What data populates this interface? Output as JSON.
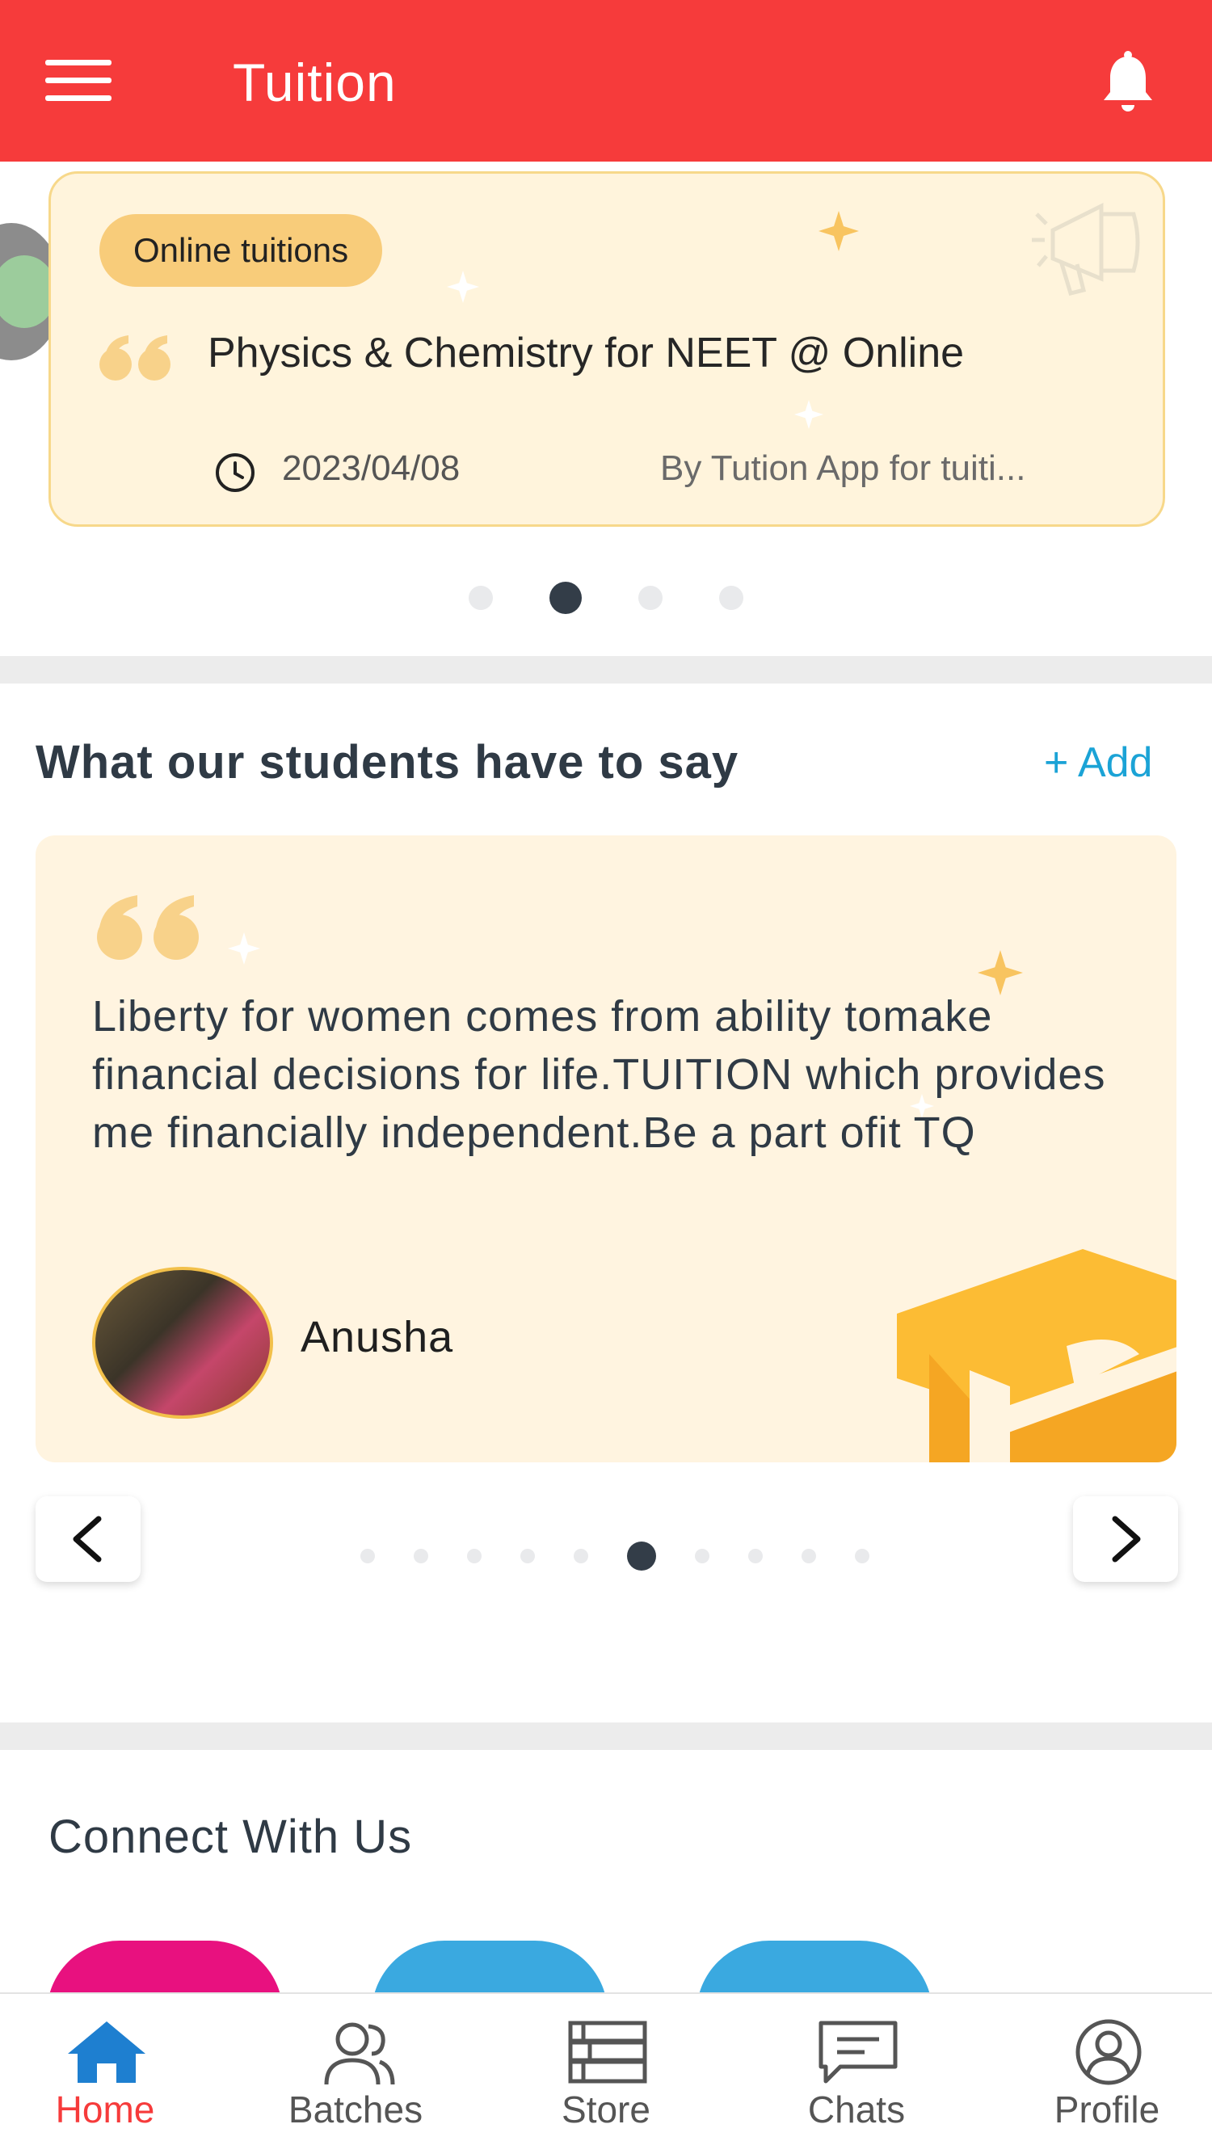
{
  "appbar": {
    "title": "Tuition"
  },
  "announcement": {
    "tag": "Online tuitions",
    "title": "Physics & Chemistry for NEET @ Online",
    "date": "2023/04/08",
    "author": "By Tution App for tuiti...",
    "dots_count": 4,
    "active_dot": 1
  },
  "testimonials": {
    "section_title": "What our students have to say",
    "add_label": "+ Add",
    "text": "Liberty for women comes from ability tomake financial decisions for life.TUITION which provides me financially independent.Be a part ofit TQ",
    "student_name": "Anusha",
    "dots_count": 10,
    "active_dot": 5
  },
  "connect": {
    "title": "Connect With Us"
  },
  "bottom_nav": {
    "items": [
      {
        "label": "Home",
        "icon": "home-icon",
        "active": true
      },
      {
        "label": "Batches",
        "icon": "batches-icon",
        "active": false
      },
      {
        "label": "Store",
        "icon": "store-icon",
        "active": false
      },
      {
        "label": "Chats",
        "icon": "chats-icon",
        "active": false
      },
      {
        "label": "Profile",
        "icon": "profile-icon",
        "active": false
      }
    ]
  },
  "colors": {
    "primary": "#f63b3b",
    "accent_link": "#1ba3d6",
    "card_bg": "#fff4dc",
    "tag_bg": "#f8cc7a",
    "social_instagram": "#e8117f",
    "social_blue": "#3aa9e0"
  }
}
